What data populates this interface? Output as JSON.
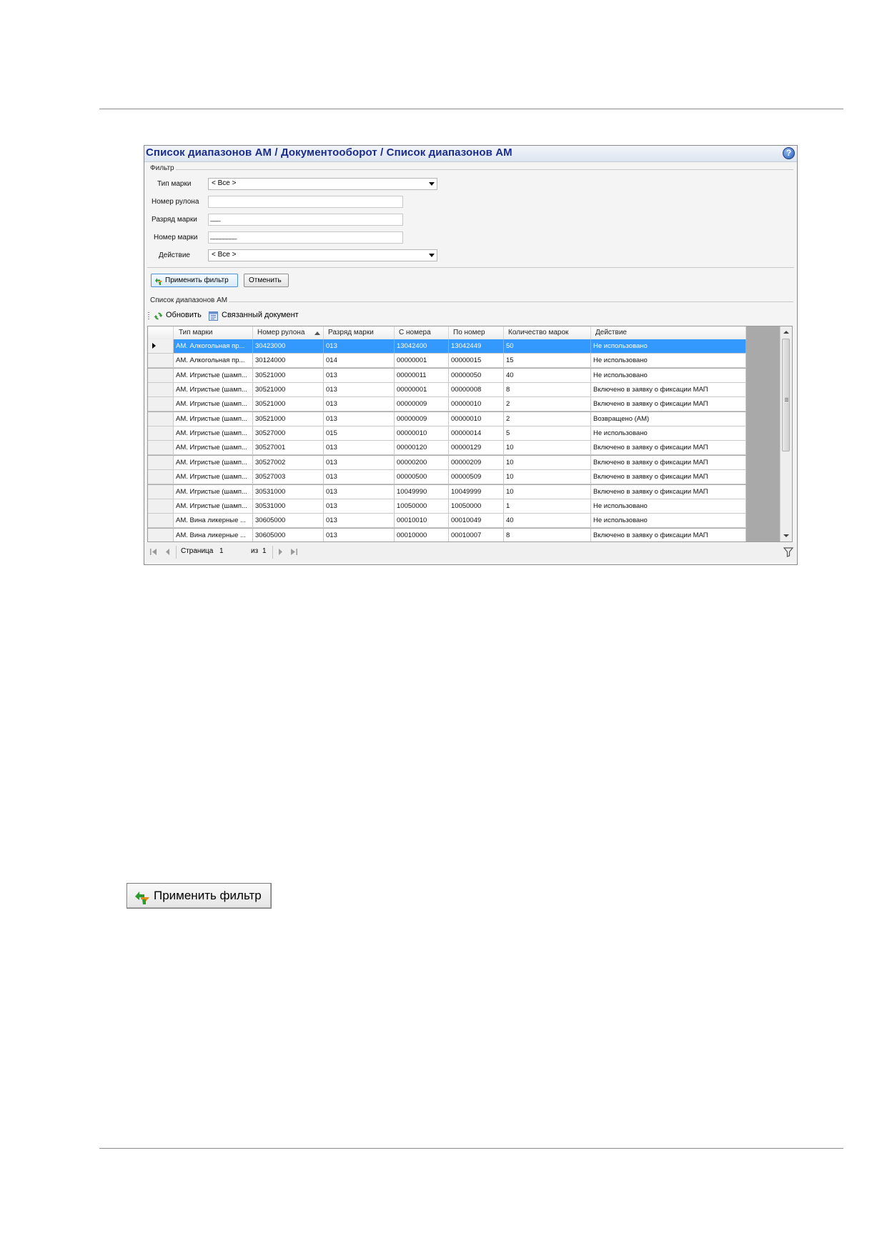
{
  "window": {
    "title": "Список диапазонов АМ / Документооборот / Список диапазонов АМ",
    "help_glyph": "?"
  },
  "filter": {
    "group_label": "Фильтр",
    "fields": [
      {
        "label": "Тип марки",
        "type": "select",
        "value": "< Все >"
      },
      {
        "label": "Номер рулона",
        "type": "text",
        "value": ""
      },
      {
        "label": "Разряд марки",
        "type": "text",
        "value": "___"
      },
      {
        "label": "Номер марки",
        "type": "text",
        "value": "________"
      },
      {
        "label": "Действие",
        "type": "select",
        "value": "< Все >"
      }
    ],
    "apply_label": "Применить фильтр",
    "cancel_label": "Отменить"
  },
  "list": {
    "group_label": "Список диапазонов АМ",
    "toolbar": {
      "refresh_label": "Обновить",
      "linked_doc_label": "Связанный документ"
    },
    "columns": [
      "Тип марки",
      "Номер рулона",
      "Разряд марки",
      "С номера",
      "По номер",
      "Количество марок",
      "Действие"
    ],
    "sorted_column": "Номер рулона",
    "rows": [
      [
        "АМ. Алкогольная пр...",
        "30423000",
        "013",
        "13042400",
        "13042449",
        "50",
        "Не использовано"
      ],
      [
        "АМ. Алкогольная пр...",
        "30124000",
        "014",
        "00000001",
        "00000015",
        "15",
        "Не использовано"
      ],
      [
        "АМ. Игристые (шамп...",
        "30521000",
        "013",
        "00000011",
        "00000050",
        "40",
        "Не использовано"
      ],
      [
        "АМ. Игристые (шамп...",
        "30521000",
        "013",
        "00000001",
        "00000008",
        "8",
        "Включено в заявку о фиксации МАП"
      ],
      [
        "АМ. Игристые (шамп...",
        "30521000",
        "013",
        "00000009",
        "00000010",
        "2",
        "Включено в заявку о фиксации МАП"
      ],
      [
        "АМ. Игристые (шамп...",
        "30521000",
        "013",
        "00000009",
        "00000010",
        "2",
        "Возвращено (АМ)"
      ],
      [
        "АМ. Игристые (шамп...",
        "30527000",
        "015",
        "00000010",
        "00000014",
        "5",
        "Не использовано"
      ],
      [
        "АМ. Игристые (шамп...",
        "30527001",
        "013",
        "00000120",
        "00000129",
        "10",
        "Включено в заявку о фиксации МАП"
      ],
      [
        "АМ. Игристые (шамп...",
        "30527002",
        "013",
        "00000200",
        "00000209",
        "10",
        "Включено в заявку о фиксации МАП"
      ],
      [
        "АМ. Игристые (шамп...",
        "30527003",
        "013",
        "00000500",
        "00000509",
        "10",
        "Включено в заявку о фиксации МАП"
      ],
      [
        "АМ. Игристые (шамп...",
        "30531000",
        "013",
        "10049990",
        "10049999",
        "10",
        "Включено в заявку о фиксации МАП"
      ],
      [
        "АМ. Игристые (шамп...",
        "30531000",
        "013",
        "10050000",
        "10050000",
        "1",
        "Не использовано"
      ],
      [
        "АМ. Вина ликерные ...",
        "30605000",
        "013",
        "00010010",
        "00010049",
        "40",
        "Не использовано"
      ],
      [
        "АМ. Вина ликерные ...",
        "30605000",
        "013",
        "00010000",
        "00010007",
        "8",
        "Включено в заявку о фиксации МАП"
      ]
    ],
    "selected_row": 0
  },
  "pager": {
    "page_label": "Страница",
    "page_value": "1",
    "of_label": "из",
    "total_pages": "1"
  },
  "sample_button": {
    "label": "Применить фильтр"
  },
  "colors": {
    "title_text": "#1a2d8c",
    "selection": "#3399ff",
    "grid_empty": "#a9a9a9",
    "apply_icon_green": "#2e9a2e",
    "apply_icon_orange": "#e58a12"
  }
}
